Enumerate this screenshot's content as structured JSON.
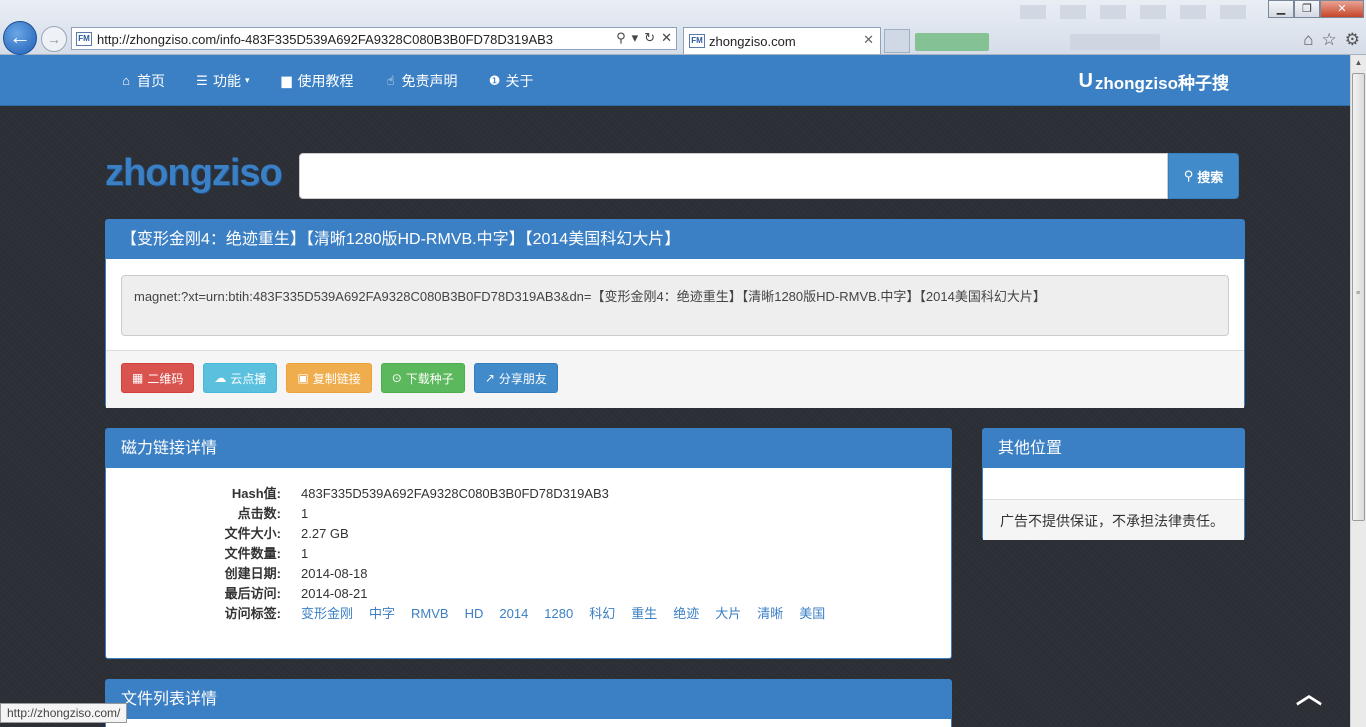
{
  "browser": {
    "address": "http://zhongziso.com/info-483F335D539A692FA9328C080B3B0FD78D319AB3",
    "tab_title": "zhongziso.com",
    "favicon_text": "FM",
    "status_url": "http://zhongziso.com/"
  },
  "nav": {
    "items": [
      {
        "icon": "home-icon",
        "label": "首页"
      },
      {
        "icon": "menu-icon",
        "label": "功能"
      },
      {
        "icon": "book-icon",
        "label": "使用教程"
      },
      {
        "icon": "hand-icon",
        "label": "免责声明"
      },
      {
        "icon": "info-icon",
        "label": "关于"
      }
    ],
    "brand": "zhongziso种子搜",
    "brand_u": "U"
  },
  "search": {
    "logo": "zhongziso",
    "button_label": "搜索",
    "input_value": ""
  },
  "torrent": {
    "title": "【变形金刚4：绝迹重生】【清晰1280版HD-RMVB.中字】【2014美国科幻大片】",
    "magnet": "magnet:?xt=urn:btih:483F335D539A692FA9328C080B3B0FD78D319AB3&dn=【变形金刚4：绝迹重生】【清晰1280版HD-RMVB.中字】【2014美国科幻大片】",
    "buttons": [
      "二维码",
      "云点播",
      "复制链接",
      "下载种子",
      "分享朋友"
    ]
  },
  "details": {
    "heading": "磁力链接详情",
    "rows": [
      {
        "label": "Hash值:",
        "value": "483F335D539A692FA9328C080B3B0FD78D319AB3"
      },
      {
        "label": "点击数:",
        "value": "1"
      },
      {
        "label": "文件大小:",
        "value": "2.27 GB"
      },
      {
        "label": "文件数量:",
        "value": "1"
      },
      {
        "label": "创建日期:",
        "value": "2014-08-18"
      },
      {
        "label": "最后访问:",
        "value": "2014-08-21"
      }
    ],
    "tags_label": "访问标签:",
    "tags": [
      "变形金刚",
      "中字",
      "RMVB",
      "HD",
      "2014",
      "1280",
      "科幻",
      "重生",
      "绝迹",
      "大片",
      "清晰",
      "美国"
    ]
  },
  "other": {
    "heading": "其他位置",
    "notice": "广告不提供保证，不承担法律责任。"
  },
  "filelist": {
    "heading": "文件列表详情"
  },
  "colors": {
    "accent": "#3b7fc4",
    "danger": "#d9534f",
    "info": "#5bc0de",
    "warning": "#f0ad4e",
    "success": "#5cb85c",
    "primary": "#428bca"
  }
}
